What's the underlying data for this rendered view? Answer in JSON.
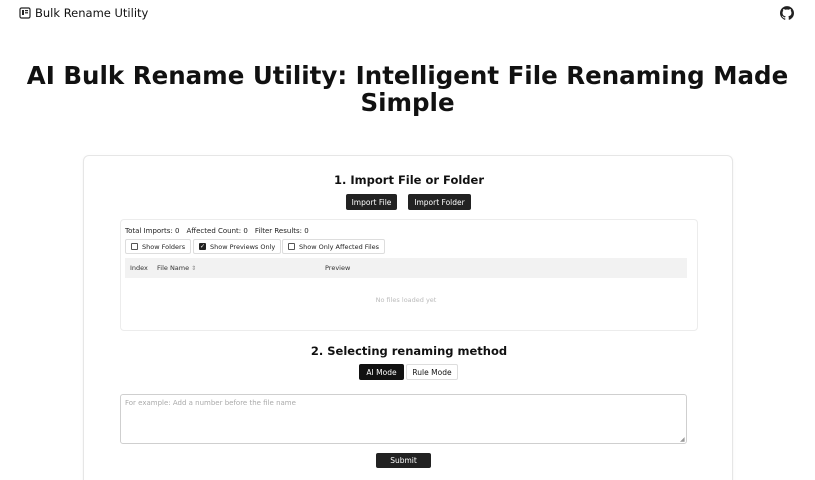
{
  "header": {
    "app_name": "Bulk Rename Utility",
    "brand_icon": "file-icon",
    "github_icon": "github-icon"
  },
  "hero": {
    "title": "AI Bulk Rename Utility: Intelligent File Renaming Made Simple"
  },
  "import_section": {
    "title": "1. Import File or Folder",
    "import_file_label": "Import File",
    "import_folder_label": "Import Folder"
  },
  "stats": {
    "total_imports": "Total Imports: 0",
    "affected_count": "Affected Count: 0",
    "filter_results": "Filter Results: 0"
  },
  "filters": {
    "show_folders": {
      "label": "Show Folders",
      "checked": false
    },
    "show_previews_only": {
      "label": "Show Previews Only",
      "checked": true
    },
    "show_only_affected": {
      "label": "Show Only Affected Files",
      "checked": false
    }
  },
  "table": {
    "columns": {
      "index": "Index",
      "file_name": "File Name",
      "preview": "Preview"
    },
    "empty_text": "No files loaded yet"
  },
  "method_section": {
    "title": "2. Selecting renaming method",
    "ai_mode_label": "AI Mode",
    "rule_mode_label": "Rule Mode",
    "active_mode": "AI Mode",
    "prompt_placeholder": "For example: Add a number before the file name",
    "prompt_value": "",
    "submit_label": "Submit"
  },
  "colors": {
    "primary_button": "#222222",
    "table_header_bg": "#f2f2f2",
    "card_border": "#e6e6e6"
  }
}
